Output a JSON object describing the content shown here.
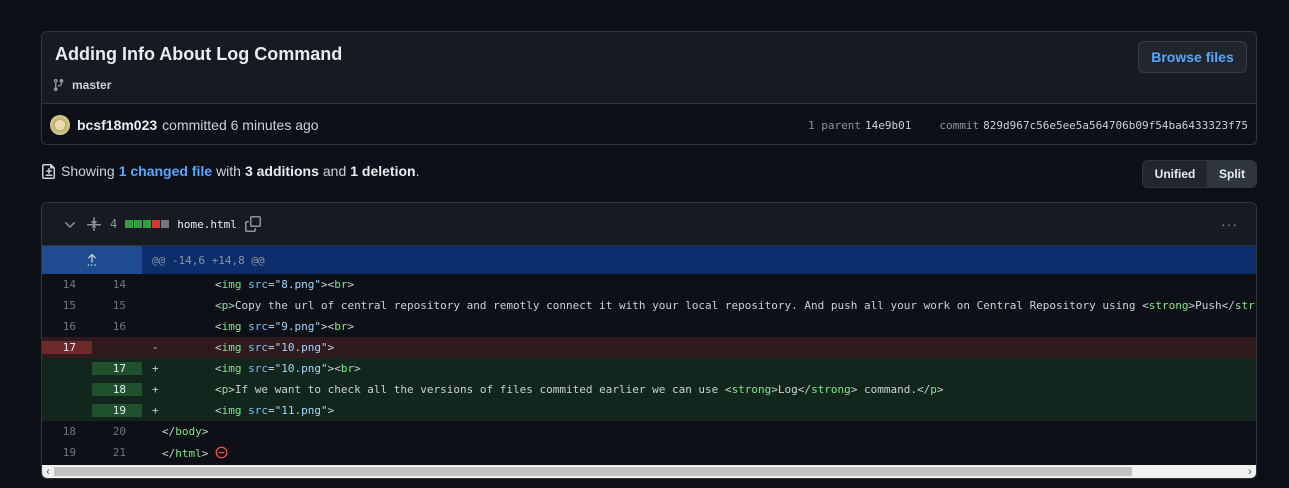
{
  "commit": {
    "title": "Adding Info About Log Command",
    "browse_label": "Browse files",
    "branch": "master",
    "author": "bcsf18m023",
    "committed_text": "committed 6 minutes ago",
    "parent_label": "1 parent",
    "parent_sha": "14e9b01",
    "commit_label": "commit",
    "commit_sha": "829d967c56e5ee5a564706b09f54ba6433323f75"
  },
  "summary": {
    "prefix": "Showing",
    "changed_link": "1 changed file",
    "with": "with",
    "additions": "3 additions",
    "and": "and",
    "deletions": "1 deletion",
    "period": "."
  },
  "view_toggle": {
    "unified": "Unified",
    "split": "Split"
  },
  "file": {
    "change_count": "4",
    "name": "home.html",
    "hunk": "@@ -14,6 +14,8 @@",
    "colors": {
      "add": "#2ea043",
      "del": "#da3633",
      "neutral": "#6e7681"
    }
  },
  "lines": [
    {
      "old": "14",
      "new": "14",
      "type": "ctx",
      "marker": "",
      "code": "        <img src=\"8.png\"><br>"
    },
    {
      "old": "15",
      "new": "15",
      "type": "ctx",
      "marker": "",
      "code": "        <p>Copy the url of central repository and remotly connect it with your local repository. And push all your work on Central Repository using <strong>Push</str"
    },
    {
      "old": "16",
      "new": "16",
      "type": "ctx",
      "marker": "",
      "code": "        <img src=\"9.png\"><br>"
    },
    {
      "old": "17",
      "new": "",
      "type": "del",
      "marker": "-",
      "code": "        <img src=\"10.png\">"
    },
    {
      "old": "",
      "new": "17",
      "type": "add",
      "marker": "+",
      "code": "        <img src=\"10.png\"><br>"
    },
    {
      "old": "",
      "new": "18",
      "type": "add",
      "marker": "+",
      "code": "        <p>If we want to check all the versions of files commited earlier we can use <strong>Log</strong> command.</p>"
    },
    {
      "old": "",
      "new": "19",
      "type": "add",
      "marker": "+",
      "code": "        <img src=\"11.png\">"
    },
    {
      "old": "18",
      "new": "20",
      "type": "ctx",
      "marker": "",
      "code": "</body>"
    },
    {
      "old": "19",
      "new": "21",
      "type": "ctx",
      "marker": "",
      "code": "</html>"
    }
  ]
}
